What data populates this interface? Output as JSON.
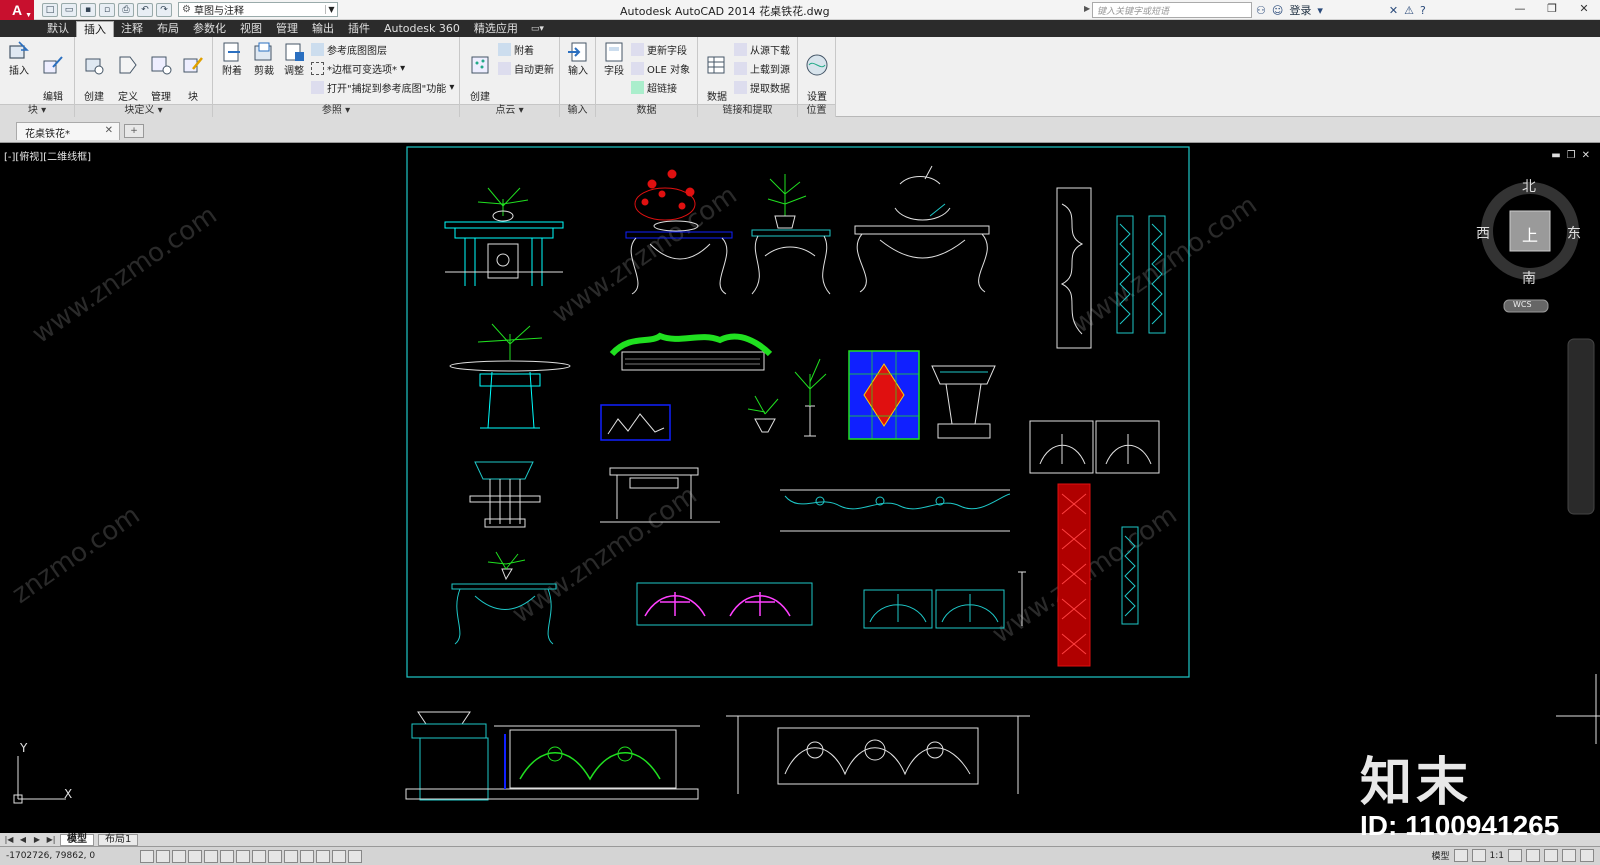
{
  "app": {
    "logo": "A",
    "window_title": "Autodesk AutoCAD 2014    花桌铁花.dwg",
    "workspace": "草图与注释",
    "search_placeholder": "键入关键字或短语",
    "login": "登录"
  },
  "ribbon_tabs": [
    "默认",
    "插入",
    "注释",
    "布局",
    "参数化",
    "视图",
    "管理",
    "输出",
    "插件",
    "Autodesk 360",
    "精选应用"
  ],
  "ribbon_active_tab": "插入",
  "panels": {
    "block": {
      "title": "块",
      "buttons": [
        "插入",
        "编辑\n属性"
      ]
    },
    "block_def": {
      "title": "块定义",
      "buttons": [
        "创建\n块",
        "定义\n属性",
        "管理\n属性",
        "块\n编辑器"
      ]
    },
    "reference": {
      "title": "参照",
      "buttons": [
        "附着",
        "剪裁",
        "调整"
      ],
      "small": [
        "参考底图图层",
        "*边框可变选项*",
        "打开\"捕捉到参考底图\"功能"
      ]
    },
    "pointcloud": {
      "title": "点云",
      "buttons": [
        "创建\n点云"
      ],
      "small": [
        "附着",
        "自动更新"
      ]
    },
    "import": {
      "title": "输入",
      "buttons": [
        "输入"
      ]
    },
    "data": {
      "title": "数据",
      "buttons": [
        "字段"
      ],
      "small": [
        "更新字段",
        "OLE 对象",
        "超链接"
      ]
    },
    "linking": {
      "title": "链接和提取",
      "buttons": [
        "数据\n链接"
      ],
      "small": [
        "从源下载",
        "上载到源",
        "提取数据"
      ]
    },
    "location": {
      "title": "位置",
      "buttons": [
        "设置\n位置"
      ]
    }
  },
  "document": {
    "tab": "花桌铁花*"
  },
  "viewport": {
    "label": "[-][俯视][二维线框]"
  },
  "viewcube": {
    "north": "北",
    "south": "南",
    "east": "东",
    "west": "西",
    "top": "上",
    "wcs": "WCS"
  },
  "layout_tabs": [
    "模型",
    "布局1"
  ],
  "status": {
    "coords": "-1702726,  79862,  0",
    "model": "模型",
    "scale": "1:1"
  },
  "watermark": {
    "brand": "知末",
    "id": "ID: 1100941265"
  },
  "colors": {
    "frame": "#1ec8c8",
    "cyan": "#00ffff",
    "green": "#20e020",
    "red": "#e01010",
    "magenta": "#ff40ff",
    "blue": "#1020ff",
    "white": "#f0f0f0"
  }
}
